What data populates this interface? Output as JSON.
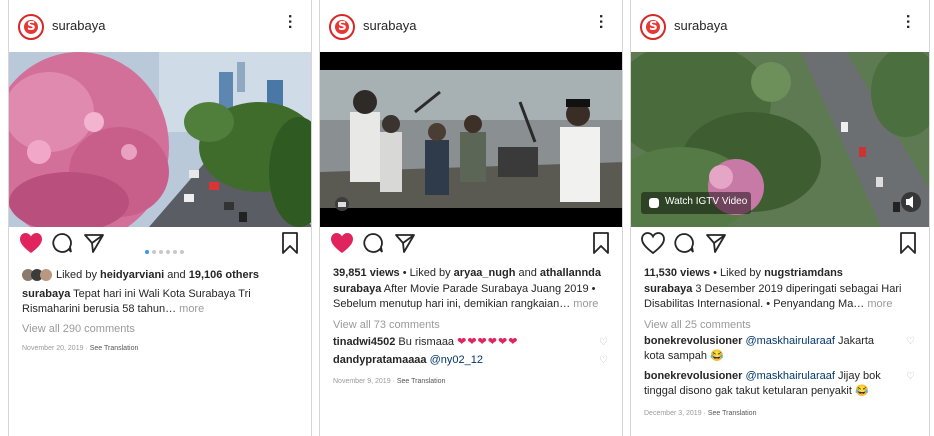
{
  "posts": [
    {
      "username": "surabaya",
      "likes_prefix": "Liked by ",
      "liked_by": "heidyarviani",
      "likes_mid": " and ",
      "likes_count": "19,106 others",
      "caption_user": "surabaya",
      "caption_line1": " Tepat hari ini Wali Kota Surabaya Tri",
      "caption_line2": "Rismaharini berusia 58 tahun…",
      "more": " more",
      "view_comments": "View all 290 comments",
      "date": "November 20, 2019",
      "see_translation": "See Translation"
    },
    {
      "username": "surabaya",
      "views": "39,851 views",
      "liked_text": " • Liked by ",
      "liked_by": "aryaa_nugh",
      "likes_mid": " and ",
      "likes_others": "athallannda",
      "caption_user": "surabaya",
      "caption_line1": " After Movie Parade Surabaya Juang 2019 •",
      "caption_line2": "Sebelum menutup hari ini, demikian rangkaian…",
      "more": " more",
      "view_comments": "View all 73 comments",
      "comments": [
        {
          "user": "tinadwi4502",
          "text": " Bu rismaaa",
          "hearts": "❤❤❤❤❤❤"
        },
        {
          "user": "dandypratamaaaa",
          "mention": " @ny02_12"
        }
      ],
      "date": "November 9, 2019",
      "see_translation": "See Translation"
    },
    {
      "username": "surabaya",
      "igtv_label": "Watch IGTV Video",
      "views": "11,530 views",
      "liked_text": " • Liked by ",
      "liked_by": "nugstriamdans",
      "caption_user": "surabaya",
      "caption_line1": " 3 Desember 2019 diperingati sebagai Hari",
      "caption_line2": "Disabilitas Internasional. • Penyandang Ma…",
      "more": " more",
      "view_comments": "View all 25 comments",
      "comments": [
        {
          "user": "bonekrevolusioner",
          "mention": " @maskhairularaaf",
          "text": " Jakarta",
          "line2": "kota sampah 😂"
        },
        {
          "user": "bonekrevolusioner",
          "mention": " @maskhairularaaf",
          "text": " Jijay bok",
          "line2": "tinggal disono gak takut ketularan penyakit 😂"
        }
      ],
      "date": "December 3, 2019",
      "see_translation": "See Translation"
    }
  ],
  "colors": {
    "like_red": "#e0245e",
    "link_blue": "#00376b",
    "muted": "#9a9a9a"
  },
  "icons": [
    "heart-icon",
    "comment-icon",
    "share-icon",
    "bookmark-icon",
    "more-icon",
    "igtv-icon",
    "mute-icon",
    "camera-icon"
  ]
}
